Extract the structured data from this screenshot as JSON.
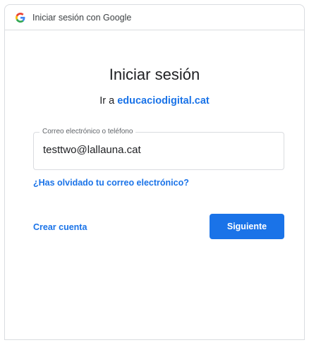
{
  "window": {
    "title": "Iniciar sesión con Google",
    "icon": "google-g-icon"
  },
  "signin": {
    "heading": "Iniciar sesión",
    "subheading_prefix": "Ir a ",
    "subheading_link": "educaciodigital.cat"
  },
  "email_field": {
    "label": "Correo electrónico o teléfono",
    "value": "testtwo@lallauna.cat"
  },
  "links": {
    "forgot_email": "¿Has olvidado tu correo electrónico?",
    "create_account": "Crear cuenta"
  },
  "buttons": {
    "next": "Siguiente"
  },
  "colors": {
    "accent": "#1a73e8",
    "text": "#202124",
    "border": "#dadce0"
  }
}
